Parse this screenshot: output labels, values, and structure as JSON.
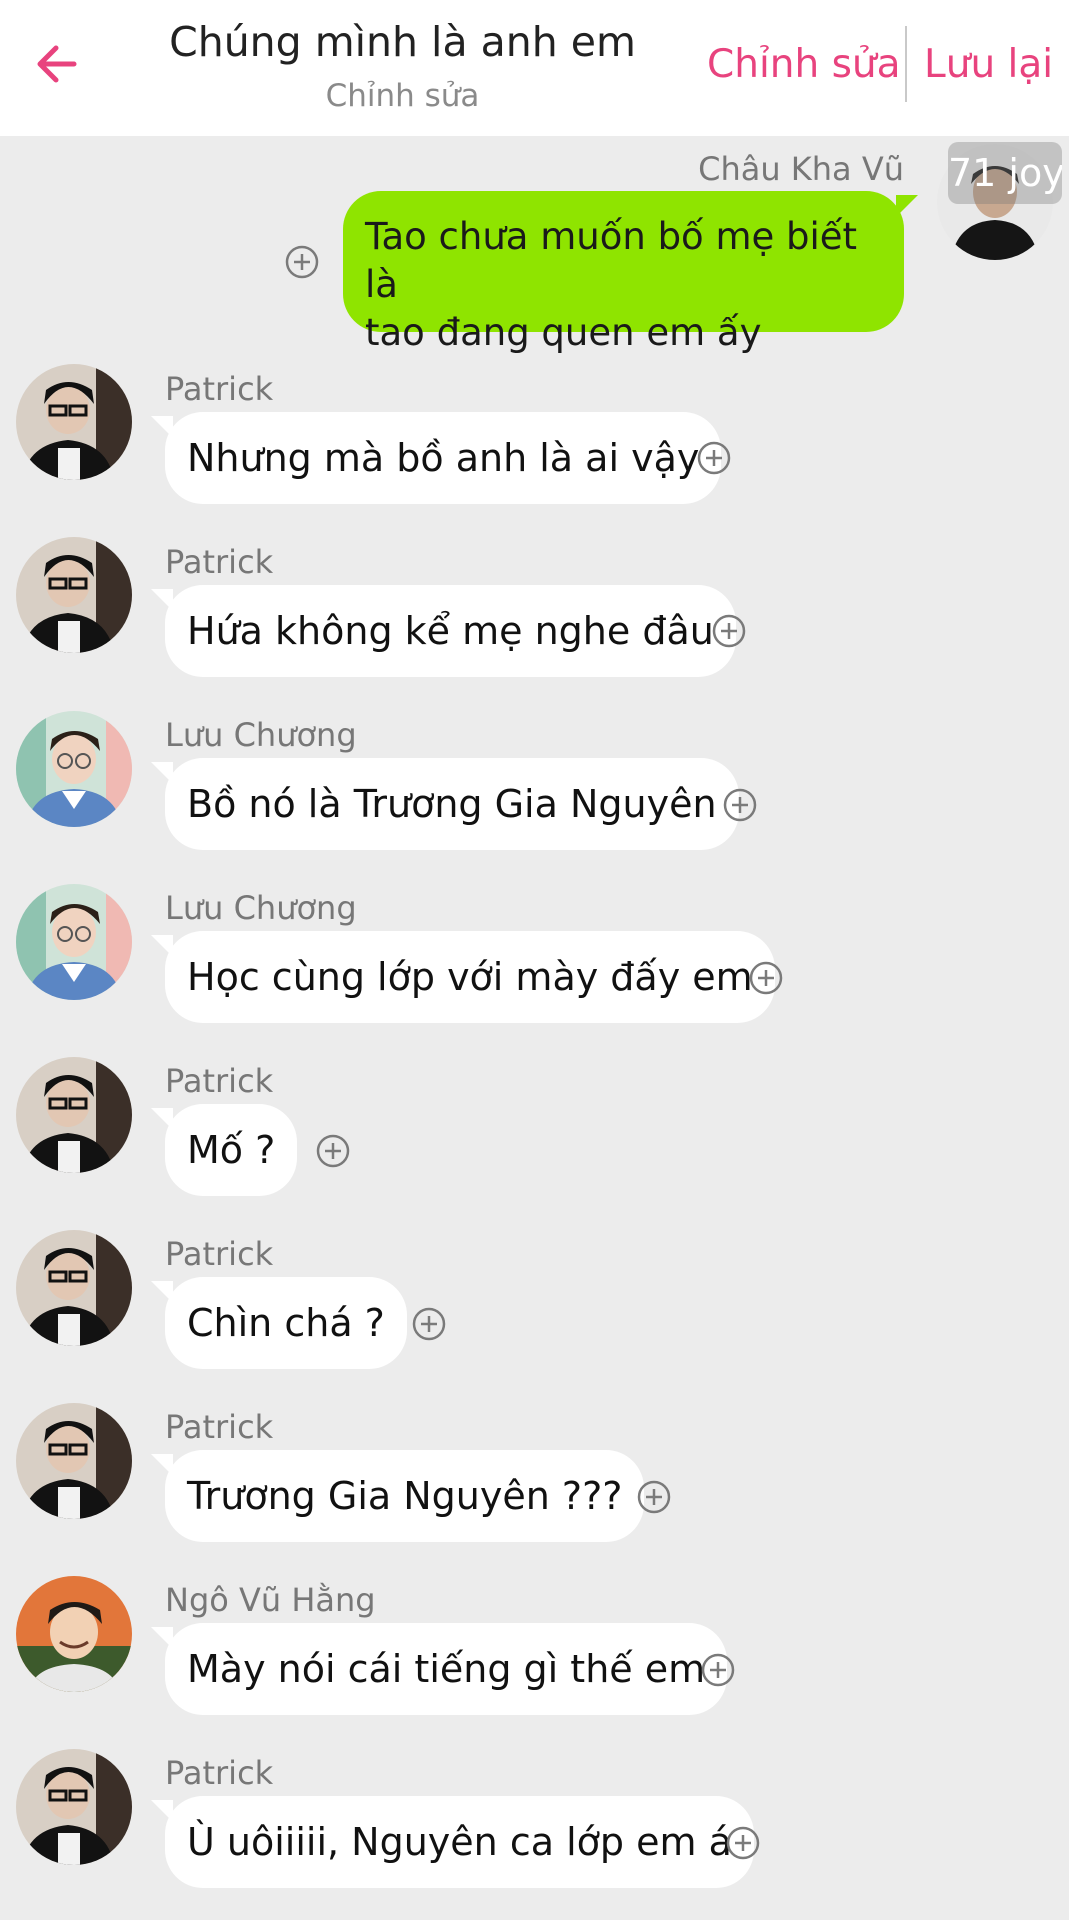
{
  "header": {
    "title": "Chúng mình là anh em",
    "subtitle": "Chỉnh sửa",
    "edit_label": "Chỉnh sửa",
    "save_label": "Lưu lại",
    "accent_color": "#e8437e"
  },
  "outgoing": {
    "sender": "Châu Kha Vũ",
    "text_line1": "Tao chưa muốn bố mẹ biết là",
    "text_line2": "tao đang quen em ấy",
    "badge": "71 joy",
    "bubble_color": "#8fe400"
  },
  "messages": [
    {
      "sender": "Patrick",
      "text": "Nhưng mà bồ anh là ai vậy"
    },
    {
      "sender": "Patrick",
      "text": "Hứa không kể mẹ nghe đâu"
    },
    {
      "sender": "Lưu Chương",
      "text": "Bồ nó là Trương Gia Nguyên"
    },
    {
      "sender": "Lưu Chương",
      "text": "Học cùng lớp với mày đấy em"
    },
    {
      "sender": "Patrick",
      "text": "Mố ?"
    },
    {
      "sender": "Patrick",
      "text": "Chìn chá ?"
    },
    {
      "sender": "Patrick",
      "text": "Trương Gia Nguyên ???"
    },
    {
      "sender": "Ngô Vũ Hằng",
      "text": "Mày nói cái tiếng gì thế em"
    },
    {
      "sender": "Patrick",
      "text": "Ù uôiiiii, Nguyên ca lớp em á"
    }
  ],
  "icons": {
    "back": "arrow-left-icon",
    "add": "plus-circle-icon"
  }
}
